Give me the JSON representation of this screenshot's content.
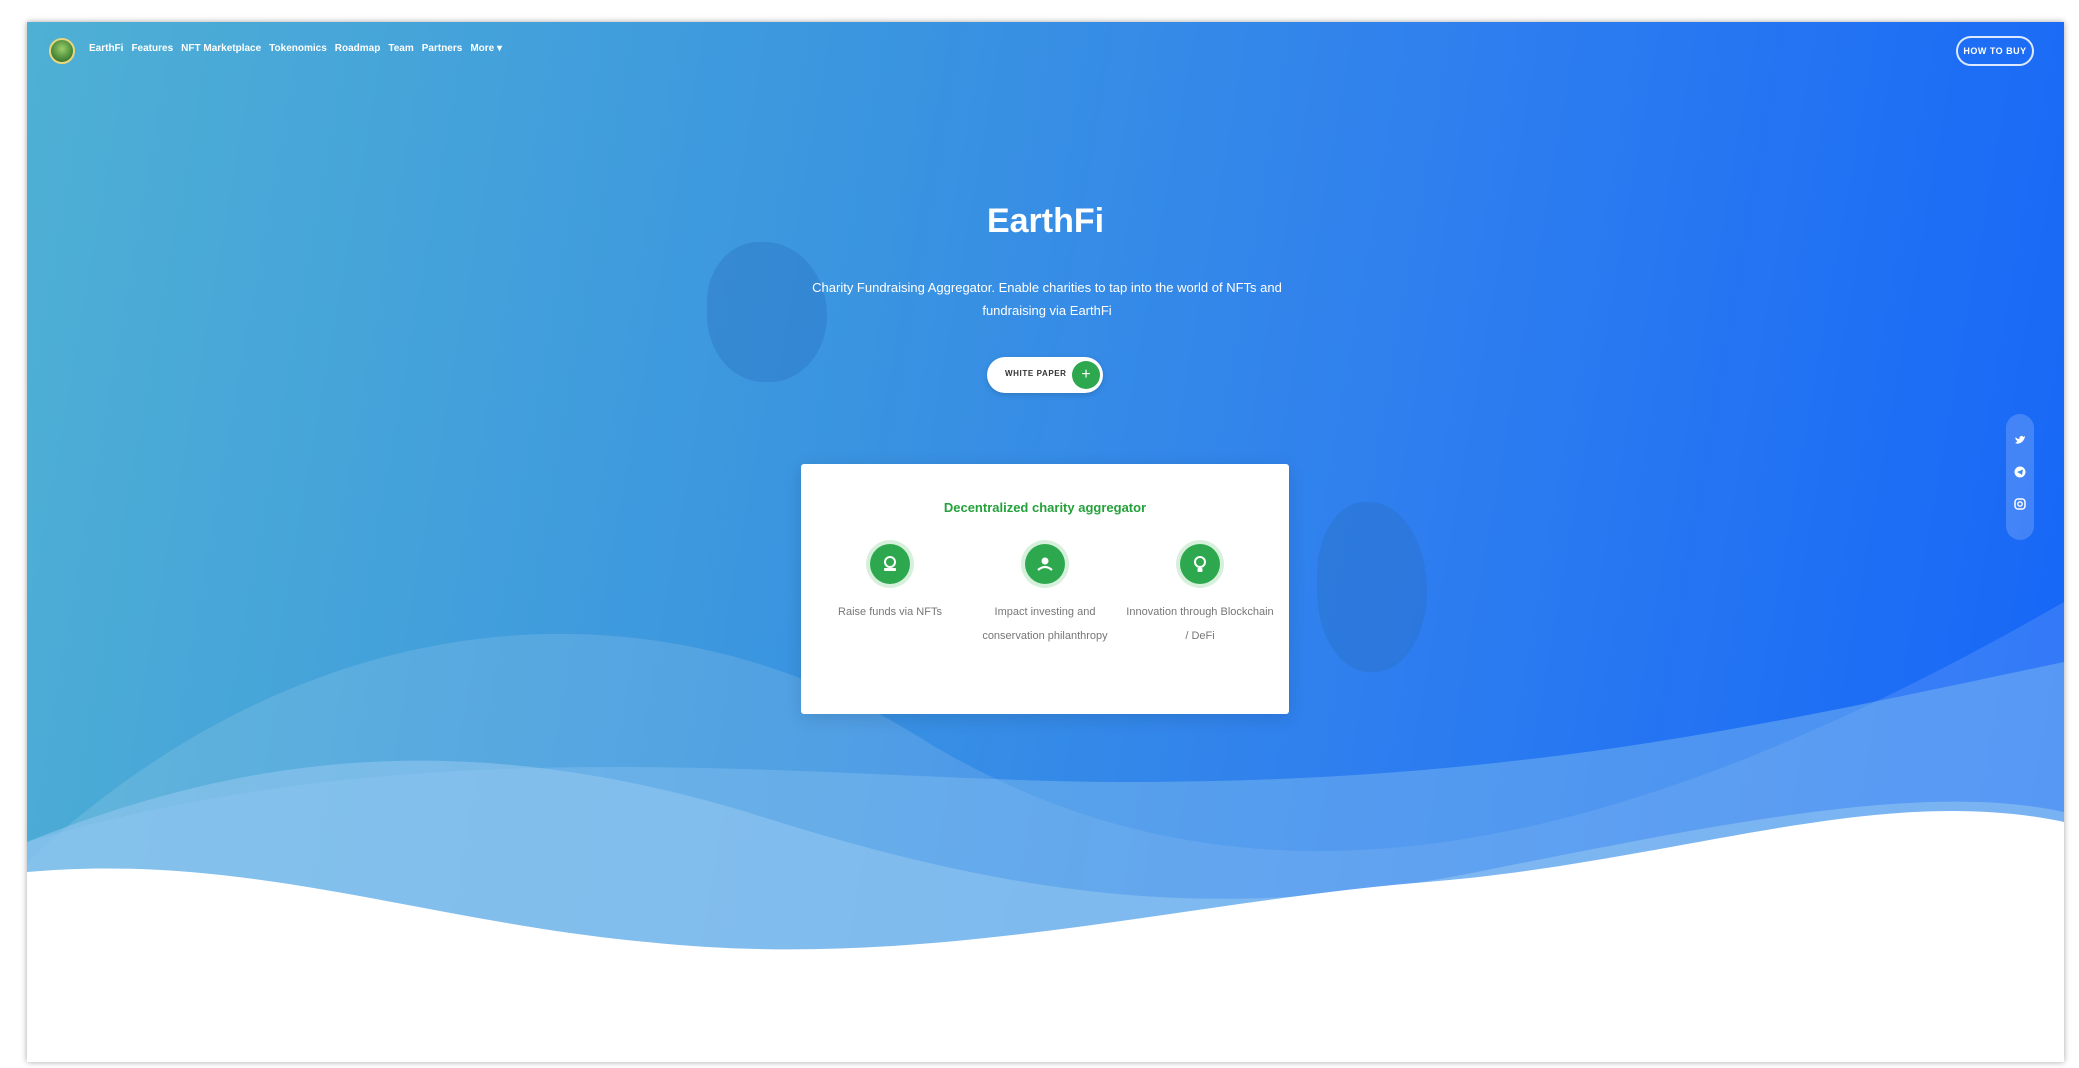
{
  "nav": {
    "items": [
      "EarthFi",
      "Features",
      "NFT Marketplace",
      "Tokenomics",
      "Roadmap",
      "Team",
      "Partners",
      "More ▾"
    ],
    "cta": "HOW TO BUY"
  },
  "hero": {
    "title": "EarthFi",
    "subtitle": "Charity Fundraising Aggregator. Enable charities to tap into the world of NFTs and fundraising via EarthFi",
    "button_label": "WHITE PAPER",
    "button_icon": "+"
  },
  "card": {
    "title": "Decentralized charity aggregator",
    "features": [
      {
        "icon": "money-icon",
        "label": "Raise funds via NFTs"
      },
      {
        "icon": "hand-heart-icon",
        "label": "Impact investing and conservation philanthropy"
      },
      {
        "icon": "lightbulb-icon",
        "label": "Innovation through Blockchain / DeFi"
      }
    ]
  },
  "social": [
    "twitter-icon",
    "telegram-icon",
    "instagram-icon"
  ],
  "colors": {
    "gradient_start": "#4fb0d4",
    "gradient_end": "#1565f8",
    "accent_green": "#2ea84e",
    "card_title": "#24a13a"
  }
}
